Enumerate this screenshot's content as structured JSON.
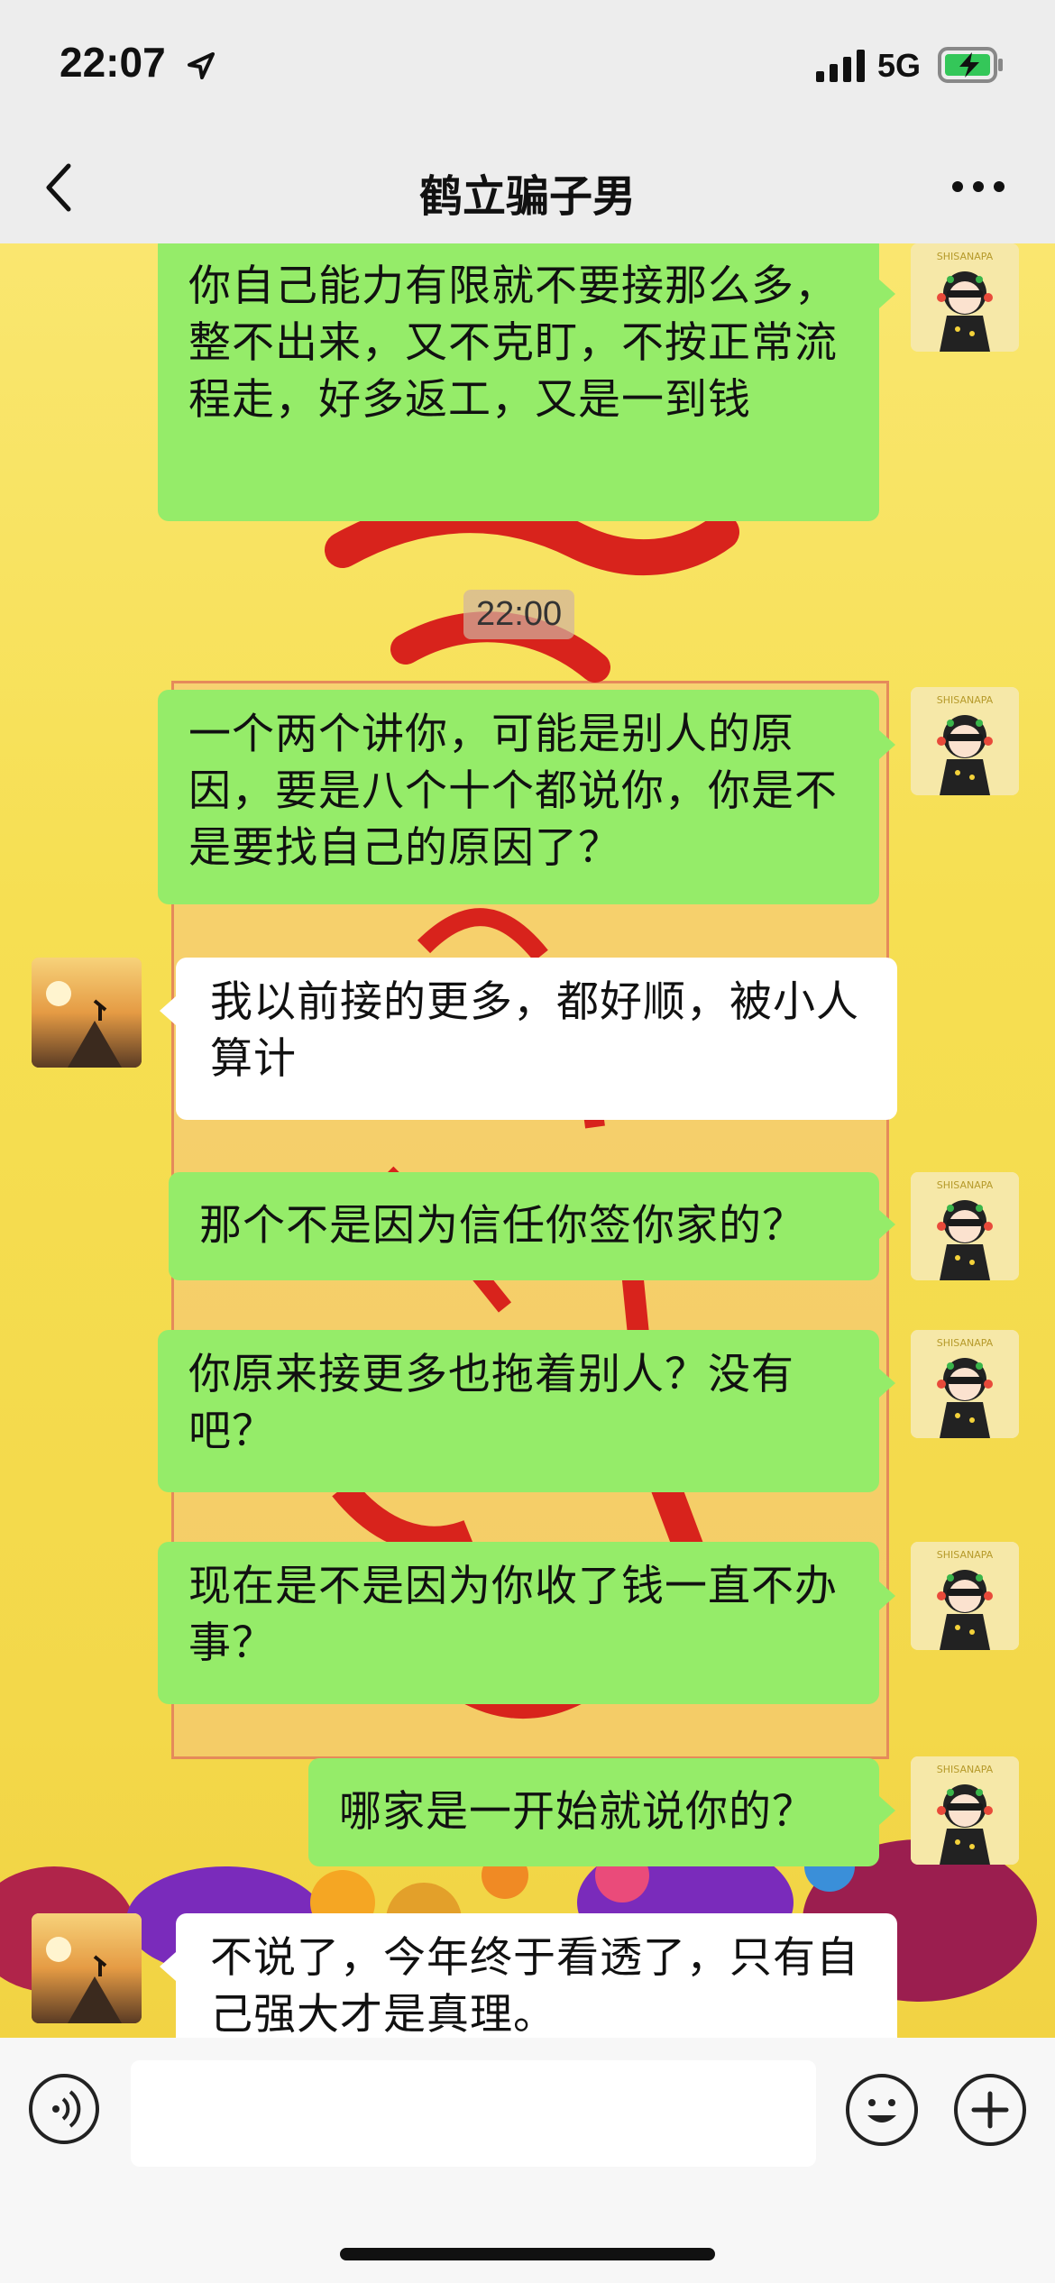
{
  "status_bar": {
    "time": "22:07",
    "network": "5G",
    "icons": [
      "location-arrow-icon",
      "signal-icon",
      "battery-charging-icon"
    ]
  },
  "nav": {
    "title": "鹤立骗子男",
    "back_icon": "chevron-left-icon",
    "more_icon": "more-dots-icon"
  },
  "chat": {
    "timestamp": "22:00",
    "messages": [
      {
        "sender": "me",
        "text": "你自己能力有限就不要接那么多，整不出来，又不克盯，不按正常流程走，好多返工，又是一到钱"
      },
      {
        "sender": "me",
        "text": "一个两个讲你，可能是别人的原因，要是八个十个都说你，你是不是要找自己的原因了？"
      },
      {
        "sender": "them",
        "text": "我以前接的更多，都好顺，被小人算计"
      },
      {
        "sender": "me",
        "text": "那个不是因为信任你签你家的？"
      },
      {
        "sender": "me",
        "text": "你原来接更多也拖着别人？没有吧？"
      },
      {
        "sender": "me",
        "text": "现在是不是因为你收了钱一直不办事？"
      },
      {
        "sender": "me",
        "text": "哪家是一开始就说你的？"
      },
      {
        "sender": "them",
        "text": "不说了，今年终于看透了，只有自己强大才是真理。"
      }
    ],
    "avatar_me_text": "SHISANAPA"
  },
  "input_bar": {
    "placeholder": "",
    "icons": [
      "voice-icon",
      "emoji-icon",
      "plus-icon"
    ]
  },
  "colors": {
    "my_bubble": "#95ec69",
    "their_bubble": "#ffffff",
    "bar_bg": "#ededed"
  }
}
